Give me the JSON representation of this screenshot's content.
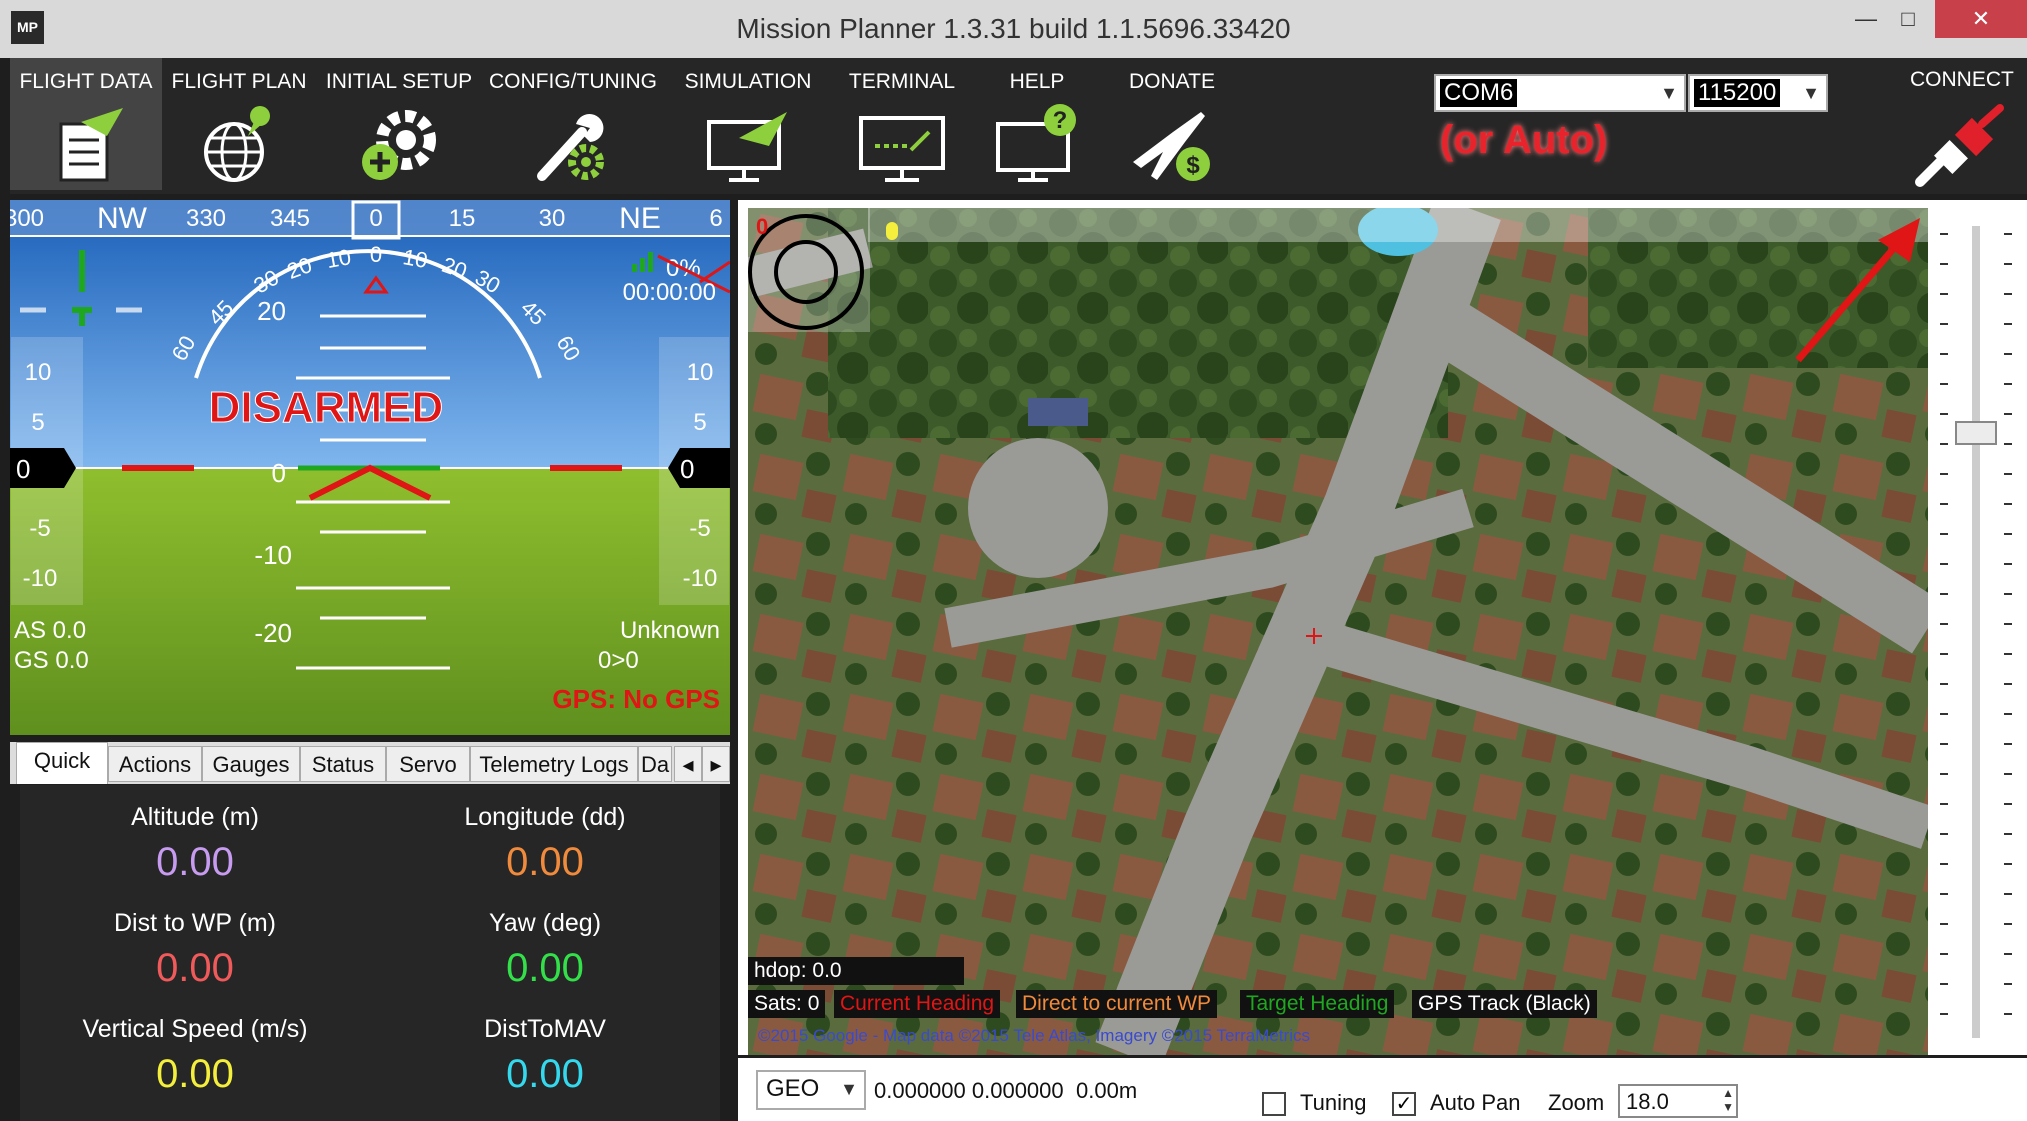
{
  "window": {
    "title": "Mission Planner 1.3.31 build 1.1.5696.33420",
    "logo_text": "MP",
    "min_glyph": "—",
    "max_glyph": "□",
    "close_glyph": "✕"
  },
  "menu": {
    "items": [
      {
        "label": "FLIGHT DATA"
      },
      {
        "label": "FLIGHT PLAN"
      },
      {
        "label": "INITIAL SETUP"
      },
      {
        "label": "CONFIG/TUNING"
      },
      {
        "label": "SIMULATION"
      },
      {
        "label": "TERMINAL"
      },
      {
        "label": "HELP"
      },
      {
        "label": "DONATE"
      }
    ],
    "connect_label": "CONNECT"
  },
  "connection": {
    "port": "COM6",
    "baud": "115200",
    "annotation": "(or Auto)"
  },
  "hud": {
    "heading_ticks": [
      "300",
      "NW",
      "330",
      "345",
      "0",
      "15",
      "30",
      "NE",
      "6"
    ],
    "pitch_labels": [
      "20",
      "10",
      "0",
      "-10",
      "-20"
    ],
    "roll_labels": [
      "60",
      "45",
      "30",
      "20",
      "10",
      "0",
      "10",
      "20",
      "30",
      "45",
      "60"
    ],
    "speed_ticks": [
      "10",
      "5",
      "-5",
      "-10"
    ],
    "alt_ticks": [
      "10",
      "5",
      "-5",
      "-10"
    ],
    "speed_value": "0",
    "alt_value": "0",
    "status": "DISARMED",
    "battery": "0%",
    "timer": "00:00:00",
    "airspeed": "AS 0.0",
    "groundspeed": "GS 0.0",
    "mode": "Unknown",
    "wp": "0>0",
    "gps": "GPS: No GPS",
    "colors": {
      "sky": "#2d7fd6",
      "ground": "#7dad2a",
      "alert": "#e01515"
    }
  },
  "tabs": [
    {
      "label": "Quick"
    },
    {
      "label": "Actions"
    },
    {
      "label": "Gauges"
    },
    {
      "label": "Status"
    },
    {
      "label": "Servo"
    },
    {
      "label": "Telemetry Logs"
    },
    {
      "label": "Da"
    }
  ],
  "tab_scroll": {
    "left": "◂",
    "right": "▸"
  },
  "quick": [
    {
      "label": "Altitude (m)",
      "value": "0.00",
      "color": "#c79bf0"
    },
    {
      "label": "Longitude (dd)",
      "value": "0.00",
      "color": "#f08a3c"
    },
    {
      "label": "Dist to WP (m)",
      "value": "0.00",
      "color": "#f05a5a"
    },
    {
      "label": "Yaw (deg)",
      "value": "0.00",
      "color": "#33e04a"
    },
    {
      "label": "Vertical Speed (m/s)",
      "value": "0.00",
      "color": "#f4ee3c"
    },
    {
      "label": "DistToMAV",
      "value": "0.00",
      "color": "#34d9ee"
    }
  ],
  "map": {
    "red_counter": "0",
    "hdop": "hdop: 0.0",
    "sats": "Sats: 0",
    "legend": [
      {
        "label": "Current Heading",
        "color": "#e01515"
      },
      {
        "label": "Direct to current WP",
        "color": "#f08a3c"
      },
      {
        "label": "Target Heading",
        "color": "#1fa71f"
      },
      {
        "label": "GPS Track (Black)",
        "color": "#ffffff"
      }
    ],
    "attribution": "©2015 Google - Map data ©2015 Tele Atlas, Imagery ©2015 TerraMetrics"
  },
  "bottom": {
    "coord_system": "GEO",
    "coords": "0.000000 0.000000",
    "altitude": "0.00m",
    "tuning_label": "Tuning",
    "tuning_checked": false,
    "autopan_label": "Auto Pan",
    "autopan_checked": true,
    "zoom_label": "Zoom",
    "zoom_value": "18.0"
  }
}
